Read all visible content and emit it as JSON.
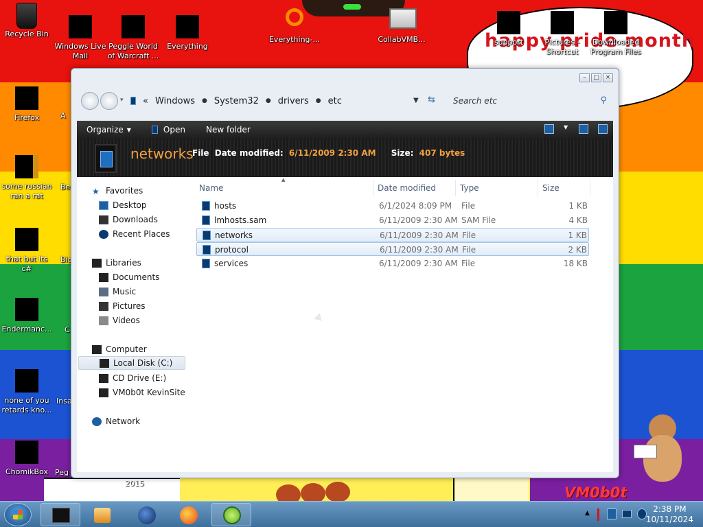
{
  "wallpaper": {
    "stripes": [
      "#e8120f",
      "#ff8a00",
      "#ffdd00",
      "#1aa33e",
      "#1b53d3",
      "#7a1fa0"
    ],
    "banner_text": "happy pride month",
    "logo_text": "VM0b0t",
    "year_text": "2015"
  },
  "desktop_icons_left": [
    {
      "label": "Recycle Bin"
    },
    {
      "label": "Windows Live Mail"
    },
    {
      "label": "Peggle World of Warcraft ..."
    },
    {
      "label": "Everything"
    },
    {
      "label": "Firefox"
    },
    {
      "label": "some russian ran a rat"
    },
    {
      "label": "that but its c#"
    },
    {
      "label": "Endermanc..."
    },
    {
      "label": "none of you retards kno..."
    },
    {
      "label": "ChomikBox"
    }
  ],
  "desktop_icons_partial": [
    "A",
    "Be",
    "Big",
    "C",
    "Insa",
    "Peg"
  ],
  "desktop_icons_top": [
    {
      "label": "Everything-..."
    },
    {
      "label": "CollabVMB..."
    },
    {
      "label": "support"
    },
    {
      "label": "Pictures - Shortcut"
    },
    {
      "label": "Downloaded Program Files"
    }
  ],
  "window": {
    "breadcrumb": [
      "Windows",
      "System32",
      "drivers",
      "etc"
    ],
    "search_placeholder": "Search etc",
    "toolbar": {
      "organize": "Organize",
      "open": "Open",
      "new_folder": "New folder"
    },
    "details": {
      "name": "networks",
      "type": "File",
      "modified_label": "Date modified:",
      "modified_value": "6/11/2009 2:30 AM",
      "size_label": "Size:",
      "size_value": "407 bytes"
    },
    "nav": {
      "favorites": "Favorites",
      "desktop": "Desktop",
      "downloads": "Downloads",
      "recent": "Recent Places",
      "libraries": "Libraries",
      "documents": "Documents",
      "music": "Music",
      "pictures": "Pictures",
      "videos": "Videos",
      "computer": "Computer",
      "local_disk": "Local Disk (C:)",
      "cd_drive": "CD Drive (E:)",
      "kevinsite": "VM0b0t KevinSite",
      "network": "Network"
    },
    "columns": {
      "name": "Name",
      "date": "Date modified",
      "type": "Type",
      "size": "Size"
    },
    "files": [
      {
        "name": "hosts",
        "date": "6/1/2024 8:09 PM",
        "type": "File",
        "size": "1 KB"
      },
      {
        "name": "lmhosts.sam",
        "date": "6/11/2009 2:30 AM",
        "type": "SAM File",
        "size": "4 KB"
      },
      {
        "name": "networks",
        "date": "6/11/2009 2:30 AM",
        "type": "File",
        "size": "1 KB"
      },
      {
        "name": "protocol",
        "date": "6/11/2009 2:30 AM",
        "type": "File",
        "size": "2 KB"
      },
      {
        "name": "services",
        "date": "6/11/2009 2:30 AM",
        "type": "File",
        "size": "18 KB"
      }
    ]
  },
  "taskbar": {
    "time": "2:38 PM",
    "date": "10/11/2024"
  }
}
